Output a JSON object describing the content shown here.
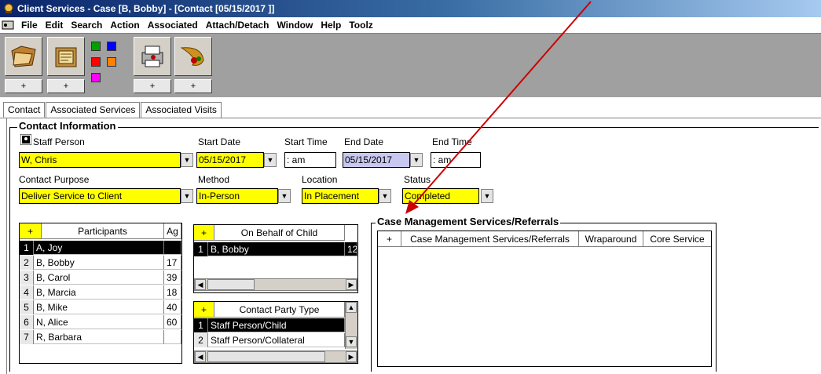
{
  "window": {
    "title": "Client Services - Case [B, Bobby] - [Contact [05/15/2017 ]]"
  },
  "menu": [
    "File",
    "Edit",
    "Search",
    "Action",
    "Associated",
    "Attach/Detach",
    "Window",
    "Help",
    "Toolz"
  ],
  "toolbar": {
    "plus_label": "+"
  },
  "tabs": [
    "Contact",
    "Associated Services",
    "Associated Visits"
  ],
  "contact_info": {
    "group_label": "Contact Information",
    "staff_person_label": "Staff Person",
    "staff_person_value": "W, Chris",
    "start_date_label": "Start Date",
    "start_date_value": "05/15/2017",
    "start_time_label": "Start Time",
    "start_time_value": ":  am",
    "end_date_label": "End Date",
    "end_date_value": "05/15/2017",
    "end_time_label": "End Time",
    "end_time_value": ":  am",
    "purpose_label": "Contact Purpose",
    "purpose_value": "Deliver Service to Client",
    "method_label": "Method",
    "method_value": "In-Person",
    "location_label": "Location",
    "location_value": "In Placement",
    "status_label": "Status",
    "status_value": "Completed"
  },
  "participants": {
    "plus": "+",
    "header_name": "Participants",
    "header_age": "Ag",
    "rows": [
      {
        "num": "1",
        "name": "A, Joy",
        "age": ""
      },
      {
        "num": "2",
        "name": "B, Bobby",
        "age": "17"
      },
      {
        "num": "3",
        "name": "B, Carol",
        "age": "39"
      },
      {
        "num": "4",
        "name": "B, Marcia",
        "age": "18"
      },
      {
        "num": "5",
        "name": "B, Mike",
        "age": "40"
      },
      {
        "num": "6",
        "name": "N, Alice",
        "age": "60"
      },
      {
        "num": "7",
        "name": "R, Barbara",
        "age": ""
      }
    ]
  },
  "on_behalf": {
    "plus": "+",
    "header": "On Behalf of Child",
    "rows": [
      {
        "num": "1",
        "name": "B, Bobby",
        "extra": "12"
      }
    ]
  },
  "contact_party": {
    "plus": "+",
    "header": "Contact Party Type",
    "rows": [
      {
        "num": "1",
        "name": "Staff Person/Child"
      },
      {
        "num": "2",
        "name": "Staff Person/Collateral"
      }
    ]
  },
  "case_mgmt": {
    "group_label": "Case Management Services/Referrals",
    "plus": "+",
    "columns": [
      "Case Management Services/Referrals",
      "Wraparound",
      "Core Service"
    ]
  },
  "colors": {
    "highlight": "#ffff00",
    "arrow": "#cc0000"
  }
}
